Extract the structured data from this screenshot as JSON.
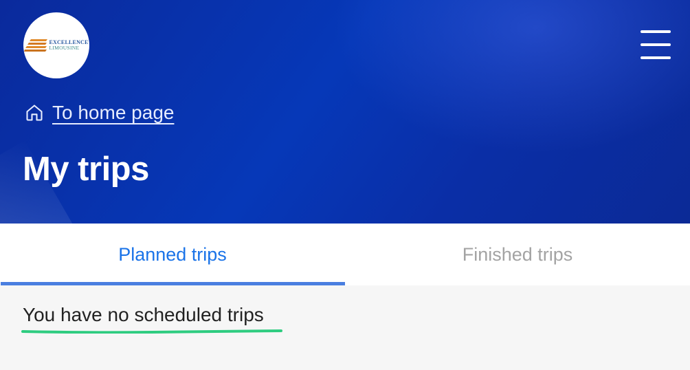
{
  "header": {
    "logo": {
      "line1": "EXCELLENCE",
      "line2": "LIMOUSINE",
      "brand_color": "#2a5aa0",
      "accent_color": "#e08a2a"
    },
    "menu_icon": "hamburger-menu-icon",
    "home_link": {
      "icon": "home-icon",
      "label": "To home page"
    },
    "title": "My trips",
    "background_color": "#0638b8"
  },
  "tabs": [
    {
      "label": "Planned trips",
      "active": true,
      "color": "#1a73e8"
    },
    {
      "label": "Finished trips",
      "active": false,
      "color": "#a3a3a3"
    }
  ],
  "content": {
    "empty_message": "You have no scheduled trips",
    "underline_color": "#2ecc80"
  }
}
